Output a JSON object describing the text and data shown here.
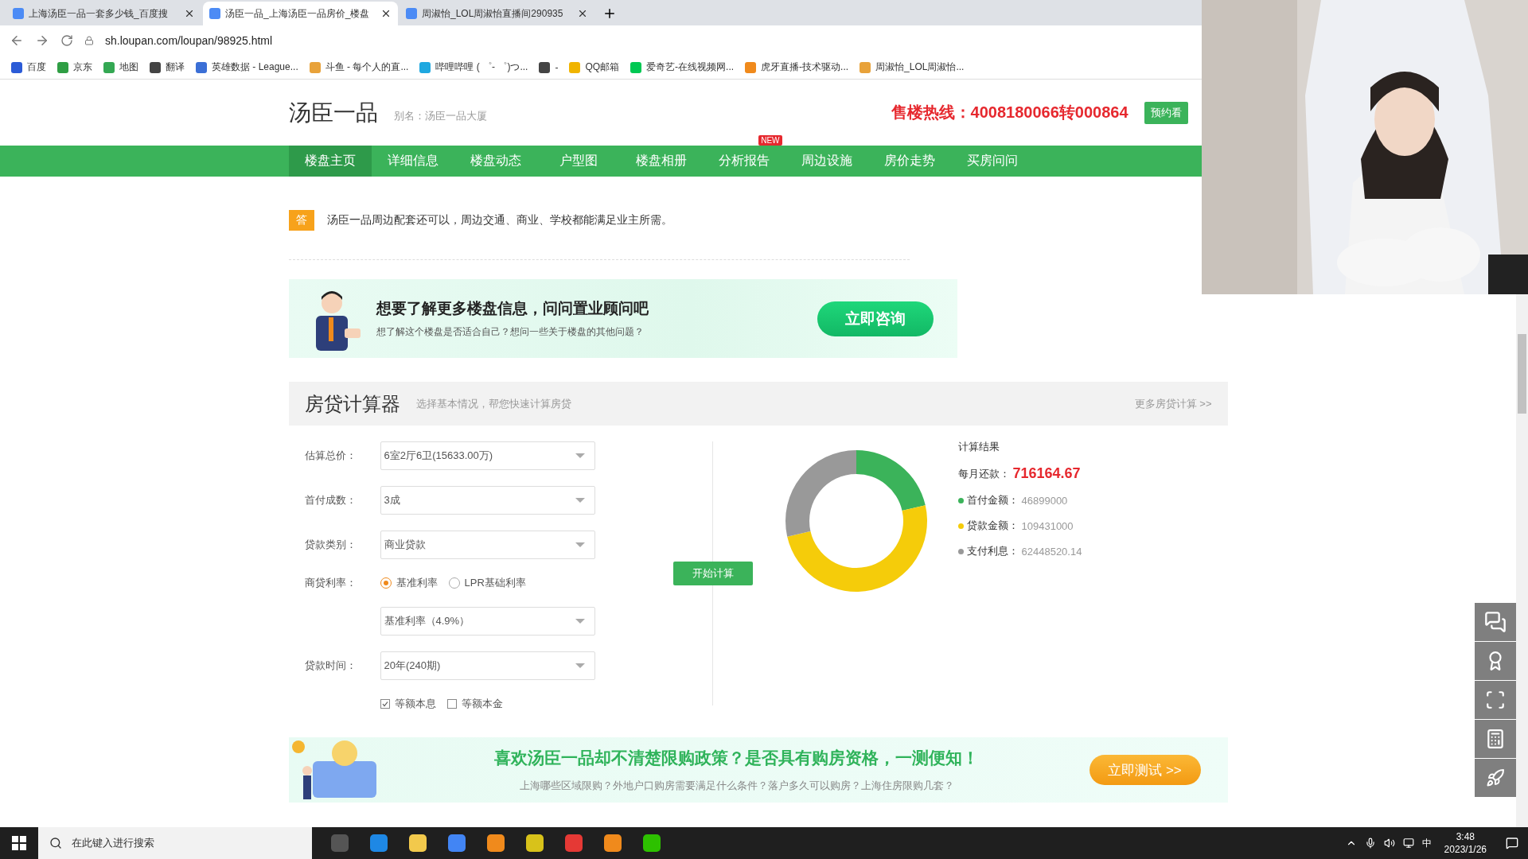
{
  "browser": {
    "tabs": [
      {
        "title": "上海汤臣一品一套多少钱_百度搜",
        "selected": false
      },
      {
        "title": "汤臣一品_上海汤臣一品房价_楼盘",
        "selected": true
      },
      {
        "title": "周淑怡_LOL周淑怡直播间290935",
        "selected": false
      }
    ],
    "address": "sh.loupan.com/loupan/98925.html",
    "bookmarks": [
      {
        "label": "百度",
        "color": "#2b5bd7"
      },
      {
        "label": "京东",
        "color": "#2f9e44"
      },
      {
        "label": "地图",
        "color": "#34a853"
      },
      {
        "label": "翻译",
        "color": "#444444"
      },
      {
        "label": "英雄数据 - League...",
        "color": "#3b6fd6"
      },
      {
        "label": "斗鱼 - 每个人的直...",
        "color": "#e8a23a"
      },
      {
        "label": "哔哩哔哩 ( ゜- ゜)つ...",
        "color": "#1fa8e0"
      },
      {
        "label": "-",
        "color": "#444444"
      },
      {
        "label": "QQ邮箱",
        "color": "#f0b400"
      },
      {
        "label": "爱奇艺-在线视频网...",
        "color": "#00c853"
      },
      {
        "label": "虎牙直播-技术驱动...",
        "color": "#f08a1c"
      },
      {
        "label": "周淑怡_LOL周淑怡...",
        "color": "#e8a23a"
      }
    ]
  },
  "header": {
    "title": "汤臣一品",
    "alias": "别名：汤臣一品大厦",
    "hotline": "售楼热线：4008180066转000864",
    "book_button": "预约看"
  },
  "nav": [
    {
      "label": "楼盘主页",
      "selected": true
    },
    {
      "label": "详细信息",
      "selected": false
    },
    {
      "label": "楼盘动态",
      "selected": false
    },
    {
      "label": "户型图",
      "selected": false
    },
    {
      "label": "楼盘相册",
      "selected": false
    },
    {
      "label": "分析报告",
      "selected": false,
      "badge": "NEW"
    },
    {
      "label": "周边设施",
      "selected": false
    },
    {
      "label": "房价走势",
      "selected": false
    },
    {
      "label": "买房问问",
      "selected": false
    }
  ],
  "answer": {
    "badge": "答",
    "text": "汤臣一品周边配套还可以，周边交通、商业、学校都能满足业主所需。"
  },
  "consult_banner": {
    "title": "想要了解更多楼盘信息，问问置业顾问吧",
    "subtitle": "想了解这个楼盘是否适合自己？想问一些关于楼盘的其他问题？",
    "button": "立即咨询"
  },
  "calculator": {
    "title": "房贷计算器",
    "subtitle": "选择基本情况，帮您快速计算房贷",
    "more_link": "更多房贷计算 >>",
    "fields": [
      {
        "kind": "select",
        "label": "估算总价：",
        "value": "6室2厅6卫(15633.00万)"
      },
      {
        "kind": "select",
        "label": "首付成数：",
        "value": "3成"
      },
      {
        "kind": "select",
        "label": "贷款类别：",
        "value": "商业贷款"
      },
      {
        "kind": "radio",
        "label": "商贷利率：",
        "options": [
          {
            "label": "基准利率",
            "selected": true
          },
          {
            "label": "LPR基础利率",
            "selected": false
          }
        ]
      },
      {
        "kind": "select",
        "value": "基准利率（4.9%）"
      },
      {
        "kind": "select",
        "label": "贷款时间：",
        "value": "20年(240期)"
      },
      {
        "kind": "checks",
        "options": [
          {
            "label": "等额本息",
            "checked": true
          },
          {
            "label": "等额本金",
            "checked": false
          }
        ]
      }
    ],
    "calc_button": "开始计算",
    "chart_data": {
      "type": "donut",
      "values": [
        21.44,
        50.02,
        28.54
      ]
    },
    "results": {
      "title": "计算结果",
      "monthly_label": "每月还款：",
      "monthly_value": "716164.67",
      "items": [
        {
          "label": "首付金额：",
          "value": "46899000",
          "color": "#3bb35a"
        },
        {
          "label": "贷款金额：",
          "value": "109431000",
          "color": "#f5cc0a"
        },
        {
          "label": "支付利息：",
          "value": "62448520.14",
          "color": "#999999"
        }
      ]
    }
  },
  "policy_banner": {
    "title": "喜欢汤臣一品却不清楚限购政策？是否具有购房资格，一测便知！",
    "subtitle": "上海哪些区域限购？外地户口购房需要满足什么条件？落户多久可以购房？上海住房限购几套？",
    "button": "立即测试 >>"
  },
  "taskbar": {
    "search_placeholder": "在此键入进行搜索",
    "ime": "中",
    "time": "3:48",
    "date": "2023/1/26"
  }
}
